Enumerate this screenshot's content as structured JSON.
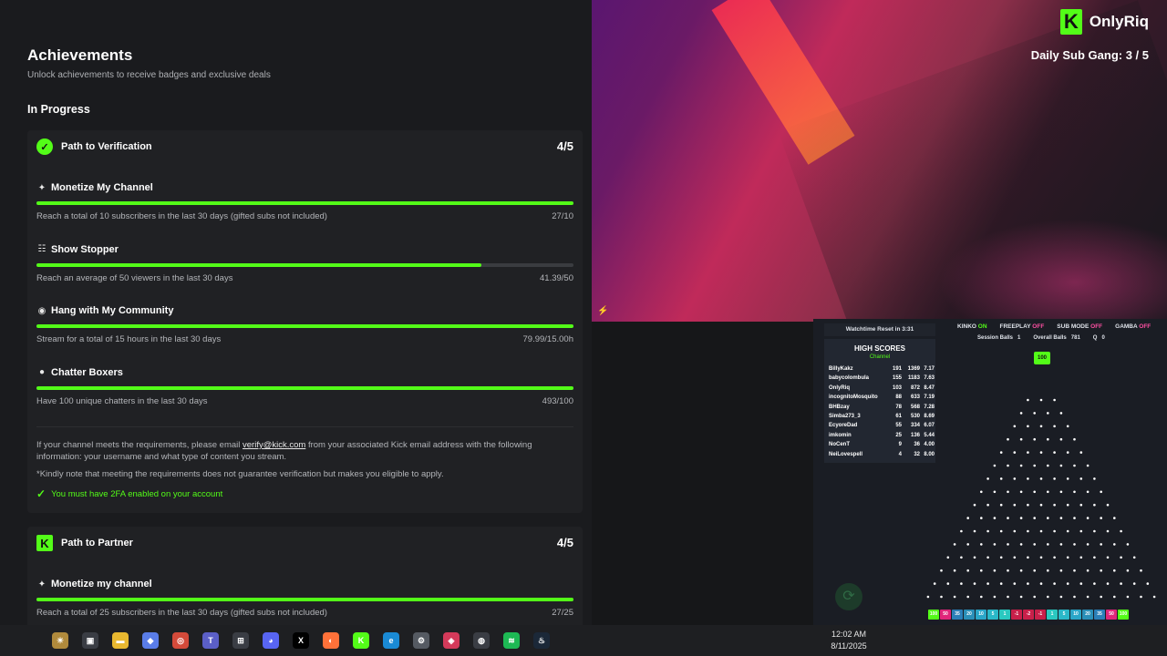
{
  "page": {
    "title": "Achievements",
    "subtitle": "Unlock achievements to receive badges and exclusive deals",
    "section": "In Progress"
  },
  "verification": {
    "title": "Path to Verification",
    "count": "4/5",
    "items": [
      {
        "icon": "sparkle-icon",
        "glyph": "✦",
        "title": "Monetize My Channel",
        "desc": "Reach a total of 10 subscribers in the last 30 days (gifted subs not included)",
        "value": "27/10",
        "progress": 1.0
      },
      {
        "icon": "people-icon",
        "glyph": "☷",
        "title": "Show Stopper",
        "desc": "Reach an average of 50 viewers in the last 30 days",
        "value": "41.39/50",
        "progress": 0.828
      },
      {
        "icon": "broadcast-icon",
        "glyph": "◉",
        "title": "Hang with My Community",
        "desc": "Stream for a total of 15 hours in the last 30 days",
        "value": "79.99/15.00h",
        "progress": 1.0
      },
      {
        "icon": "chat-icon",
        "glyph": "●",
        "title": "Chatter Boxers",
        "desc": "Have 100 unique chatters in the last 30 days",
        "value": "493/100",
        "progress": 1.0
      }
    ],
    "info_pre": "If your channel meets the requirements, please email ",
    "info_link": "verify@kick.com",
    "info_post": " from your associated Kick email address with the following information: your username and what type of content you stream.",
    "note": "*Kindly note that meeting the requirements does not guarantee verification but makes you eligible to apply.",
    "check": "You must have 2FA enabled on your account"
  },
  "partner": {
    "title": "Path to Partner",
    "count": "4/5",
    "items": [
      {
        "icon": "sparkle-icon",
        "glyph": "✦",
        "title": "Monetize my channel",
        "desc": "Reach a total of 25 subscribers in the last 30 days (gifted subs not included)",
        "value": "27/25",
        "progress": 1.0
      }
    ]
  },
  "stream": {
    "brand": "OnlyRiq",
    "brand_k": "K",
    "subgang": "Daily Sub Gang:  3 / 5"
  },
  "plinko": {
    "watchtime": "Watchtime Reset in 3:31",
    "modes": [
      {
        "label": "KINKO",
        "state": "ON",
        "on": true
      },
      {
        "label": "FREEPLAY",
        "state": "OFF",
        "on": false
      },
      {
        "label": "SUB MODE",
        "state": "OFF",
        "on": false
      },
      {
        "label": "GAMBA",
        "state": "OFF",
        "on": false
      }
    ],
    "session_label": "Session Balls",
    "session_value": "1",
    "overall_label": "Overall Balls",
    "overall_value": "781",
    "queue_label": "Q",
    "queue_value": "0",
    "chip": "100",
    "hs_title": "HIGH SCORES",
    "hs_sub": "Channel",
    "scores": [
      [
        "BillyKakz",
        "191",
        "1369",
        "7.17"
      ],
      [
        "babycolombula",
        "155",
        "1183",
        "7.63"
      ],
      [
        "OnlyRiq",
        "103",
        "872",
        "8.47"
      ],
      [
        "incognitoMosquito",
        "88",
        "633",
        "7.19"
      ],
      [
        "BHBzay",
        "78",
        "568",
        "7.28"
      ],
      [
        "Simba273_3",
        "61",
        "530",
        "8.69"
      ],
      [
        "EcyoreDad",
        "55",
        "334",
        "6.07"
      ],
      [
        "imkomin",
        "25",
        "136",
        "5.44"
      ],
      [
        "NoCenT",
        "9",
        "36",
        "4.00"
      ],
      [
        "NeiLovespell",
        "4",
        "32",
        "8.00"
      ]
    ],
    "slots": [
      {
        "v": "100",
        "c": "#53fc18"
      },
      {
        "v": "50",
        "c": "#e0267a"
      },
      {
        "v": "35",
        "c": "#2a7fb8"
      },
      {
        "v": "20",
        "c": "#2a8fb8"
      },
      {
        "v": "10",
        "c": "#2aa6c8"
      },
      {
        "v": "5",
        "c": "#2ab8c8"
      },
      {
        "v": "1",
        "c": "#2ac8c0"
      },
      {
        "v": "-1",
        "c": "#c8204a"
      },
      {
        "v": "-2",
        "c": "#c8204a"
      },
      {
        "v": "-1",
        "c": "#c8204a"
      },
      {
        "v": "1",
        "c": "#2ac8c0"
      },
      {
        "v": "5",
        "c": "#2ab8c8"
      },
      {
        "v": "10",
        "c": "#2aa6c8"
      },
      {
        "v": "20",
        "c": "#2a8fb8"
      },
      {
        "v": "35",
        "c": "#2a7fb8"
      },
      {
        "v": "50",
        "c": "#e0267a"
      },
      {
        "v": "100",
        "c": "#53fc18"
      }
    ]
  },
  "taskbar": {
    "time": "12:02 AM",
    "date": "8/11/2025",
    "apps": [
      {
        "name": "widgets-icon",
        "glyph": "☀",
        "color": "#b08a3c"
      },
      {
        "name": "task-view-icon",
        "glyph": "▣",
        "color": "#3a3d44"
      },
      {
        "name": "file-explorer-icon",
        "glyph": "▬",
        "color": "#e8b830"
      },
      {
        "name": "copilot-icon",
        "glyph": "◆",
        "color": "#5a7de8"
      },
      {
        "name": "chrome-icon",
        "glyph": "◎",
        "color": "#d44a3a"
      },
      {
        "name": "teams-icon",
        "glyph": "T",
        "color": "#5b5fc7"
      },
      {
        "name": "store-icon",
        "glyph": "⊞",
        "color": "#3a3d44"
      },
      {
        "name": "discord-icon",
        "glyph": "◕",
        "color": "#5865f2"
      },
      {
        "name": "x-icon",
        "glyph": "X",
        "color": "#000000"
      },
      {
        "name": "firefox-icon",
        "glyph": "◐",
        "color": "#ff7139"
      },
      {
        "name": "kick-icon",
        "glyph": "K",
        "color": "#53fc18"
      },
      {
        "name": "edge-icon",
        "glyph": "e",
        "color": "#1a8ad4"
      },
      {
        "name": "settings-icon",
        "glyph": "⚙",
        "color": "#555a62"
      },
      {
        "name": "maps-icon",
        "glyph": "◈",
        "color": "#d43a5a"
      },
      {
        "name": "obs-icon",
        "glyph": "◍",
        "color": "#3a3d44"
      },
      {
        "name": "spotify-icon",
        "glyph": "≋",
        "color": "#1db954"
      },
      {
        "name": "steam-icon",
        "glyph": "♨",
        "color": "#1b2838"
      }
    ]
  }
}
